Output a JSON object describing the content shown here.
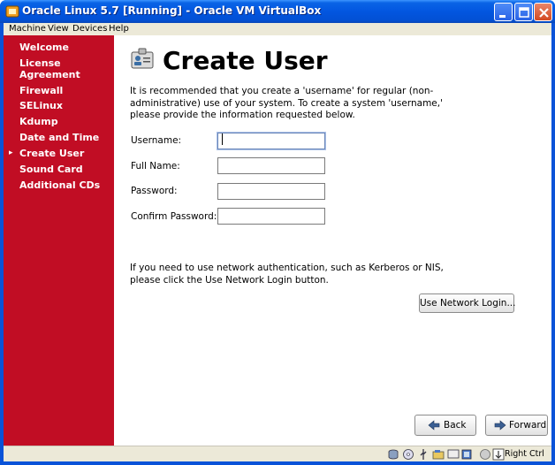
{
  "window": {
    "title": "Oracle Linux 5.7 [Running] - Oracle VM VirtualBox",
    "colors": {
      "title_bar": "#0256e0",
      "close": "#d34a22"
    }
  },
  "menubar": {
    "items": [
      "Machine",
      "View",
      "Devices",
      "Help"
    ]
  },
  "sidebar": {
    "color": "#c10d24",
    "items": [
      {
        "label": "Welcome"
      },
      {
        "label": "License Agreement"
      },
      {
        "label": "Firewall"
      },
      {
        "label": "SELinux"
      },
      {
        "label": "Kdump"
      },
      {
        "label": "Date and Time"
      },
      {
        "label": "Create User",
        "current": true
      },
      {
        "label": "Sound Card"
      },
      {
        "label": "Additional CDs"
      }
    ],
    "license_line1": "License",
    "license_line2": "Agreement"
  },
  "main": {
    "icon": "user-card-icon",
    "title": "Create User",
    "intro": "It is recommended that you create a 'username' for regular (non-administrative) use of your system. To create a system 'username,' please provide the information requested below.",
    "fields": {
      "username": {
        "label": "Username:",
        "value": ""
      },
      "full_name": {
        "label": "Full Name:",
        "value": ""
      },
      "password": {
        "label": "Password:",
        "value": ""
      },
      "confirm_password": {
        "label": "Confirm Password:",
        "value": ""
      }
    },
    "network_text": "If you need to use network authentication, such as Kerberos or NIS, please click the Use Network Login button.",
    "network_button": "Use Network Login...",
    "back_button": "Back",
    "forward_button": "Forward"
  },
  "statusbar": {
    "icons": [
      "hard-disk-icon",
      "optical-drive-icon",
      "usb-icon",
      "shared-folders-icon",
      "display-icon",
      "network-icon",
      "mouse-integration-icon",
      "host-key-icon"
    ],
    "host_key": "Right Ctrl"
  }
}
